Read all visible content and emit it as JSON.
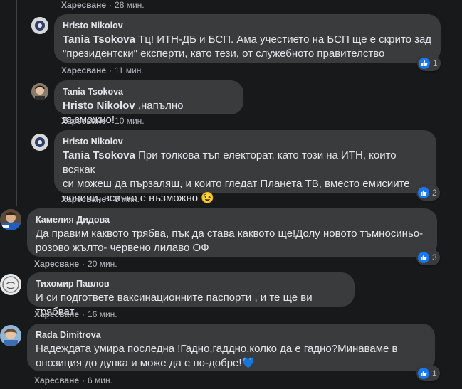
{
  "ui": {
    "like_label": "Харесване",
    "dot": "·"
  },
  "comments": [
    {
      "time": "28 мин."
    },
    {
      "author": "Hristo Nikolov",
      "mention": "Tania Tsokova",
      "text_line1": " Тц! ИТН-ДБ и БСП. Ама учестието на БСП ще е скрито зад",
      "text_line2": "\"президентски\" експерти, като тези, от служебното правителство",
      "time": "11 мин.",
      "reactions": "1"
    },
    {
      "author": "Tania Tsokova",
      "mention": "Hristo Nikolov",
      "text_line1": " ,напълно възможно!",
      "time": "10 мин."
    },
    {
      "author": "Hristo Nikolov",
      "mention": "Tania Tsokova",
      "text_line1": " При толкова тъп електорат, като този на ИТН, които всякак",
      "text_line2": "си можеш да пързаляш, и които гледат Планета ТВ, вместо емисиите",
      "text_line3": "новини, всичко е възможно ",
      "emoji": "😉",
      "time": "9 мин.",
      "reactions": "2"
    },
    {
      "author": "Камелия Дидова",
      "text_line1": "Да правим каквото трябва, пък да става каквото ще!Долу новото тъмносиньо-",
      "text_line2": "розово жълто- червено лилаво ОФ",
      "time": "20 мин.",
      "reactions": "3"
    },
    {
      "author": "Тихомир Павлов",
      "text_line1": "И си подгответе ваксинационните паспорти , и те ще ви трябват",
      "time": "16 мин."
    },
    {
      "author": "Rada Dimitrova",
      "text_line1": "Надеждата умира последна !Гадно,гаддно,колко да е гадно?Минаваме в",
      "text_line2": "опозиция до дупка и може да е по-добре!",
      "emoji": "💙",
      "time": "6 мин.",
      "reactions": "1"
    }
  ]
}
